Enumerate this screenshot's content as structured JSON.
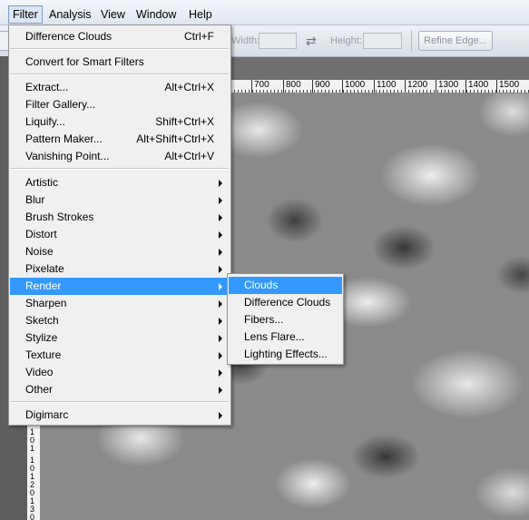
{
  "menubar": {
    "items": [
      {
        "label": "Filter",
        "open": true
      },
      {
        "label": "Analysis"
      },
      {
        "label": "View"
      },
      {
        "label": "Window"
      },
      {
        "label": "Help"
      }
    ]
  },
  "options_bar": {
    "width_label": "Width:",
    "height_label": "Height:",
    "refine_edge_label": "Refine Edge...",
    "left_fragment": "C",
    "swap_icon": "swap-arrows-icon"
  },
  "ruler": {
    "top_labels": [
      "700",
      "800",
      "900",
      "1000",
      "1100",
      "1200",
      "1300",
      "1400",
      "1500"
    ],
    "left_digits": [
      "1",
      "0",
      "1",
      "1",
      "0",
      "1",
      "2",
      "0",
      "1",
      "3",
      "0"
    ]
  },
  "filter_menu": {
    "last_filter": {
      "label": "Difference Clouds",
      "shortcut": "Ctrl+F"
    },
    "smart_filters": {
      "label": "Convert for Smart Filters"
    },
    "tools": [
      {
        "label": "Extract...",
        "shortcut": "Alt+Ctrl+X"
      },
      {
        "label": "Filter Gallery...",
        "shortcut": ""
      },
      {
        "label": "Liquify...",
        "shortcut": "Shift+Ctrl+X"
      },
      {
        "label": "Pattern Maker...",
        "shortcut": "Alt+Shift+Ctrl+X"
      },
      {
        "label": "Vanishing Point...",
        "shortcut": "Alt+Ctrl+V"
      }
    ],
    "groups": [
      {
        "label": "Artistic"
      },
      {
        "label": "Blur"
      },
      {
        "label": "Brush Strokes"
      },
      {
        "label": "Distort"
      },
      {
        "label": "Noise"
      },
      {
        "label": "Pixelate"
      },
      {
        "label": "Render",
        "highlighted": true
      },
      {
        "label": "Sharpen"
      },
      {
        "label": "Sketch"
      },
      {
        "label": "Stylize"
      },
      {
        "label": "Texture"
      },
      {
        "label": "Video"
      },
      {
        "label": "Other"
      }
    ],
    "plugins": [
      {
        "label": "Digimarc"
      }
    ]
  },
  "render_submenu": {
    "items": [
      {
        "label": "Clouds",
        "highlighted": true
      },
      {
        "label": "Difference Clouds"
      },
      {
        "label": "Fibers..."
      },
      {
        "label": "Lens Flare..."
      },
      {
        "label": "Lighting Effects..."
      }
    ]
  },
  "colors": {
    "highlight": "#3399ff",
    "menu_bg": "#f0f0f0",
    "menubar_active": "#dbe7f5"
  }
}
